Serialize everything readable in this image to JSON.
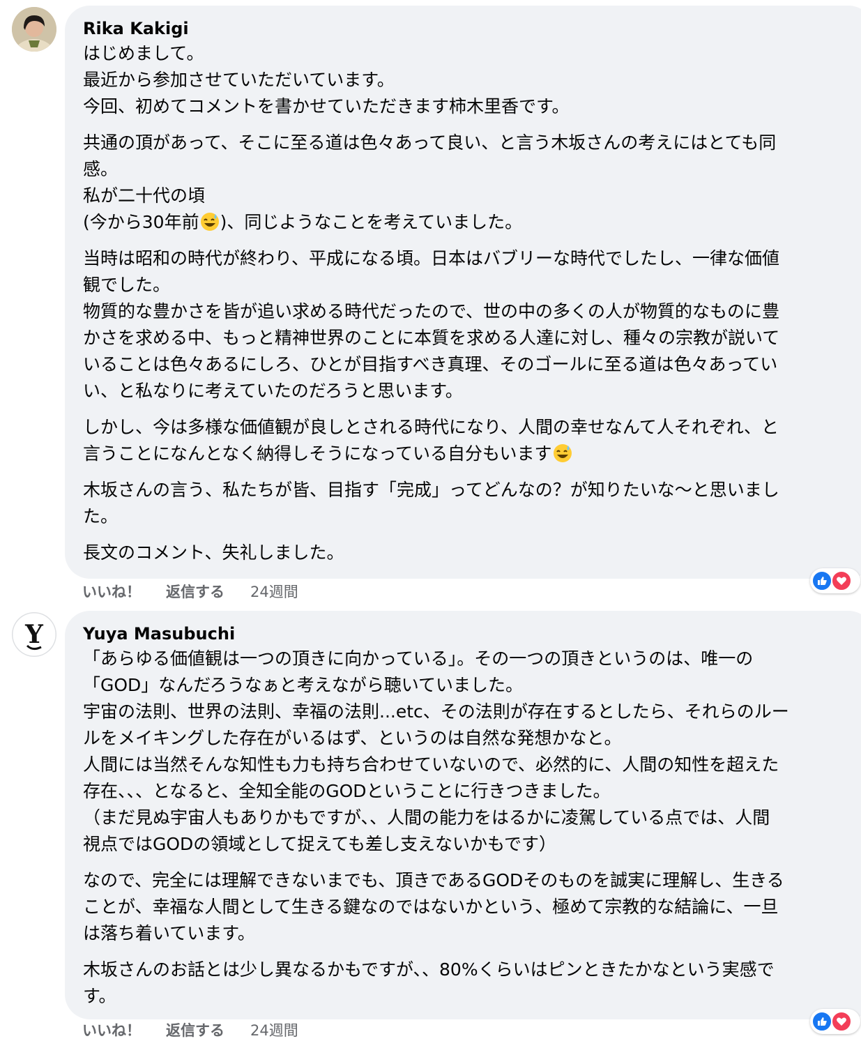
{
  "comments": [
    {
      "author": "Rika Kakigi",
      "avatar_icon": "profile-photo",
      "paragraphs": [
        [
          "はじめまして。",
          "最近から参加させていただいています。",
          "今回、初めてコメントを書かせていただきます柿木里香です。"
        ],
        [
          "共通の頂があって、そこに至る道は色々あって良い、と言う木坂さんの考えにはとても同",
          "感。",
          "私が二十代の頃"
        ],
        [
          "当時は昭和の時代が終わり、平成になる頃。日本はバブリーな時代でしたし、一律な価値",
          "観でした。",
          "物質的な豊かさを皆が追い求める時代だったので、世の中の多くの人が物質的なものに豊",
          "かさを求める中、もっと精神世界のことに本質を求める人達に対し、種々の宗教が説いて",
          "いることは色々あるにしろ、ひとが目指すべき真理、そのゴールに至る道は色々あってい",
          "い、と私なりに考えていたのだろうと思います。"
        ],
        [
          "しかし、今は多様な価値観が良しとされる時代になり、人間の幸せなんて人それぞれ、と"
        ],
        [
          "木坂さんの言う、私たちが皆、目指す「完成」ってどんなの？が知りたいな〜と思いまし",
          "た。"
        ],
        [
          "長文のコメント、失礼しました。"
        ]
      ],
      "emoji_line_1": {
        "before": "(今から30年前",
        "after": ")、同じようなことを考えていました。"
      },
      "emoji_line_2": {
        "before": "言うことになんとなく納得しそうになっている自分もいます",
        "after": ""
      },
      "actions": {
        "like": "いいね！",
        "reply": "返信する",
        "time": "24週間"
      },
      "reactions": [
        "like",
        "love"
      ]
    },
    {
      "author": "Yuya Masubuchi",
      "avatar_icon": "gothic-y-logo",
      "avatar_letter": "Y",
      "paragraphs": [
        [
          "「あらゆる価値観は一つの頂きに向かっている」。その一つの頂きというのは、唯一の",
          "「GOD」なんだろうなぁと考えながら聴いていました。",
          "宇宙の法則、世界の法則、幸福の法則...etc、その法則が存在するとしたら、それらのルー",
          "ルをメイキングした存在がいるはず、というのは自然な発想かなと。",
          "人間には当然そんな知性も力も持ち合わせていないので、必然的に、人間の知性を超えた",
          "存在、、、となると、全知全能のGODということに行きつきました。",
          "（まだ見ぬ宇宙人もありかもですが、、人間の能力をはるかに凌駕している点では、人間",
          "視点ではGODの領域として捉えても差し支えないかもです）"
        ],
        [
          "なので、完全には理解できないまでも、頂きであるGODそのものを誠実に理解し、生きる",
          "ことが、幸福な人間として生きる鍵なのではないかという、極めて宗教的な結論に、一旦",
          "は落ち着いています。"
        ],
        [
          "木坂さんのお話とは少し異なるかもですが、、80%くらいはピンときたかなという実感で",
          "す。"
        ]
      ],
      "actions": {
        "like": "いいね！",
        "reply": "返信する",
        "time": "24週間"
      },
      "reactions": [
        "like",
        "love"
      ]
    }
  ],
  "colors": {
    "bubble": "#f0f2f5",
    "meta": "#65676b",
    "like": "#1877f2",
    "love": "#f33e58"
  }
}
